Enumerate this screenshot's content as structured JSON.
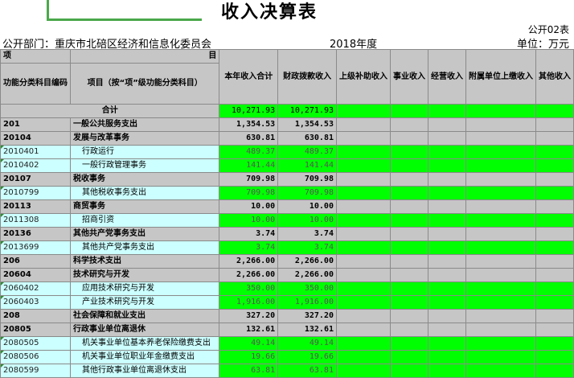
{
  "title": "收入决算表",
  "form_code": "公开02表",
  "dept_label": "公开部门：重庆市北碚区经济和信息化委员会",
  "year_label": "2018年度",
  "unit_label": "单位：万元",
  "headers": {
    "item": "项",
    "mu": "目",
    "code": "功能分类科目编码",
    "name": "项目（按“项”级功能分类科目）",
    "total": "本年收入合计",
    "fiscal": "财政拨款收入",
    "upper": "上级补助收入",
    "career": "事业收入",
    "business": "经营收入",
    "affiliate": "附属单位上缴收入",
    "other": "其他收入"
  },
  "sum_row": {
    "name": "合计",
    "total": "10,271.93",
    "fiscal": "10,271.93"
  },
  "rows": [
    {
      "code": "201",
      "name": "一般公共服务支出",
      "total": "1,354.53",
      "fiscal": "1,354.53",
      "level": 1
    },
    {
      "code": "20104",
      "name": "发展与改革事务",
      "total": "630.81",
      "fiscal": "630.81",
      "level": 2
    },
    {
      "code": "2010401",
      "name": "行政运行",
      "total": "489.37",
      "fiscal": "489.37",
      "level": 3
    },
    {
      "code": "2010402",
      "name": "一般行政管理事务",
      "total": "141.44",
      "fiscal": "141.44",
      "level": 3
    },
    {
      "code": "20107",
      "name": "税收事务",
      "total": "709.98",
      "fiscal": "709.98",
      "level": 2
    },
    {
      "code": "2010799",
      "name": "其他税收事务支出",
      "total": "709.98",
      "fiscal": "709.98",
      "level": 3
    },
    {
      "code": "20113",
      "name": "商贸事务",
      "total": "10.00",
      "fiscal": "10.00",
      "level": 2
    },
    {
      "code": "2011308",
      "name": "招商引资",
      "total": "10.00",
      "fiscal": "10.00",
      "level": 3
    },
    {
      "code": "20136",
      "name": "其他共产党事务支出",
      "total": "3.74",
      "fiscal": "3.74",
      "level": 2
    },
    {
      "code": "2013699",
      "name": "其他共产党事务支出",
      "total": "3.74",
      "fiscal": "3.74",
      "level": 3
    },
    {
      "code": "206",
      "name": "科学技术支出",
      "total": "2,266.00",
      "fiscal": "2,266.00",
      "level": 1
    },
    {
      "code": "20604",
      "name": "技术研究与开发",
      "total": "2,266.00",
      "fiscal": "2,266.00",
      "level": 2
    },
    {
      "code": "2060402",
      "name": "应用技术研究与开发",
      "total": "350.00",
      "fiscal": "350.00",
      "level": 3
    },
    {
      "code": "2060403",
      "name": "产业技术研究与开发",
      "total": "1,916.00",
      "fiscal": "1,916.00",
      "level": 3
    },
    {
      "code": "208",
      "name": "社会保障和就业支出",
      "total": "327.20",
      "fiscal": "327.20",
      "level": 1
    },
    {
      "code": "20805",
      "name": "行政事业单位离退休",
      "total": "132.61",
      "fiscal": "132.61",
      "level": 2
    },
    {
      "code": "2080505",
      "name": "机关事业单位基本养老保险缴费支出",
      "total": "49.14",
      "fiscal": "49.14",
      "level": 3
    },
    {
      "code": "2080506",
      "name": "机关事业单位职业年金缴费支出",
      "total": "19.66",
      "fiscal": "19.66",
      "level": 3
    },
    {
      "code": "2080599",
      "name": "其他行政事业单位离退休支出",
      "total": "63.81",
      "fiscal": "63.81",
      "level": 3
    }
  ],
  "colors": {
    "header_gray": "#c6c6c6",
    "detail_cyan": "#ccffff",
    "value_green": "#00ff00"
  }
}
